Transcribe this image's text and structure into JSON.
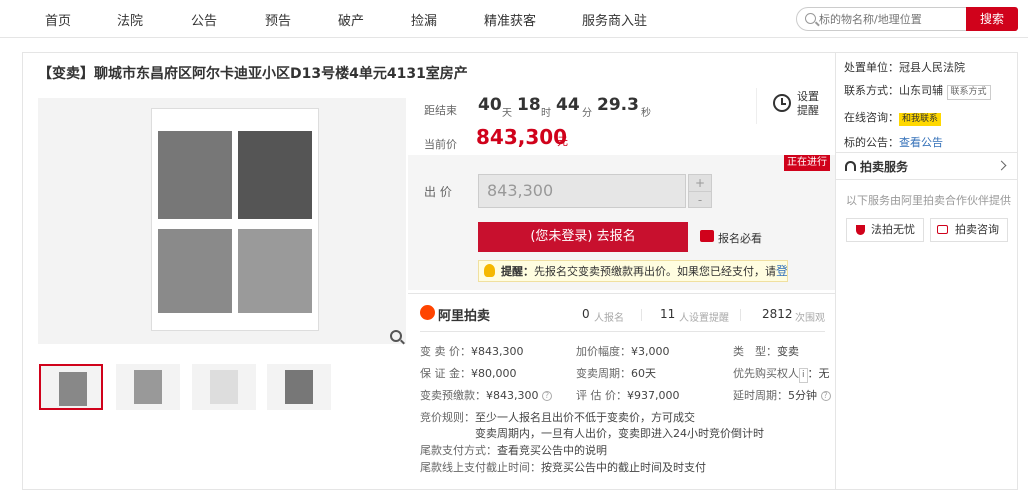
{
  "nav": {
    "items": [
      "首页",
      "法院",
      "公告",
      "预告",
      "破产",
      "捡漏",
      "精准获客",
      "服务商入驻"
    ],
    "search_placeholder": "标的物名称/地理位置",
    "search_button": "搜索"
  },
  "item": {
    "title": "【变卖】聊城市东昌府区阿尔卡迪亚小区D13号楼4单元4131室房产"
  },
  "countdown": {
    "label": "距结束",
    "days": "40",
    "days_unit": "天",
    "hours": "18",
    "hours_unit": "时",
    "minutes": "44",
    "minutes_unit": "分",
    "seconds": "29.3",
    "seconds_unit": "秒"
  },
  "current_price": {
    "label": "当前价",
    "value": "843,300",
    "unit": "元"
  },
  "remind": {
    "label": "设置提醒"
  },
  "bid": {
    "status": "正在进行",
    "label": "出 价",
    "value": "843,300",
    "plus": "+",
    "minus": "-",
    "signup": "(您未登录) 去报名",
    "must_read": "报名必看",
    "tip_prefix": "提醒：",
    "tip_text": "先报名交变卖预缴款再出价。如果您已经支付，请",
    "tip_link": "登录"
  },
  "stats": {
    "brand": "阿里拍卖",
    "signups": "0",
    "signups_label": "人报名",
    "reminders": "11",
    "reminders_label": "人设置提醒",
    "views": "2812",
    "views_label": "次围观"
  },
  "details": {
    "sale_price_k": "变 卖 价：",
    "sale_price_v": "¥843,300",
    "increment_k": "加价幅度：",
    "increment_v": "¥3,000",
    "type_k": "类　型：",
    "type_v": "变卖",
    "deposit_k": "保 证 金：",
    "deposit_v": "¥80,000",
    "period_k": "变卖周期：",
    "period_v": "60天",
    "priority_k": "优先购买权人",
    "priority_badge": "i",
    "priority_v": "：无",
    "prepay_k": "变卖预缴款：",
    "prepay_v": "¥843,300",
    "appraisal_k": "评 估 价：",
    "appraisal_v": "¥937,000",
    "delay_k": "延时周期：",
    "delay_v": "5分钟",
    "rule_k": "竞价规则：",
    "rule_1": "至少一人报名且出价不低于变卖价，方可成交",
    "rule_2": "变卖周期内，一旦有人出价，变卖即进入24小时竞价倒计时",
    "payment_k": "尾款支付方式：",
    "payment_v": "查看竞买公告中的说明",
    "deadline_k": "尾款线上支付截止时间：",
    "deadline_v": "按竞买公告中的截止时间及时支付"
  },
  "sidebar": {
    "court_k": "处置单位：",
    "court_v": "冠县人民法院",
    "contact_k": "联系方式：",
    "contact_v": "山东司辅",
    "contact_btn": "联系方式",
    "consult_k": "在线咨询：",
    "consult_v": "和我联系",
    "notice_k": "标的公告：",
    "notice_v": "查看公告",
    "service_title": "拍卖服务",
    "service_note": "以下服务由阿里拍卖合作伙伴提供",
    "btn_legal": "法拍无忧",
    "btn_consult": "拍卖咨询"
  }
}
